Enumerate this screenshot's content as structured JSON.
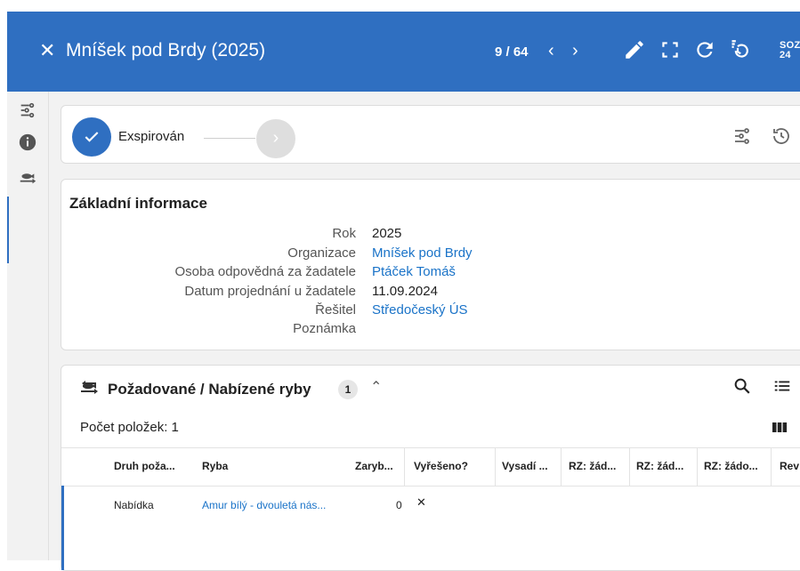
{
  "header": {
    "close_icon": "close-icon",
    "title": "Mníšek pod Brdy (2025)",
    "pager": "9 / 64",
    "prev": "‹",
    "next": "›",
    "actions": [
      "edit-icon",
      "fullscreen-icon",
      "refresh-icon",
      "history-icon"
    ],
    "logo": [
      "SOZ",
      "24"
    ],
    "bg_color": "#2f6fc1"
  },
  "rail": {
    "items": [
      "workflow-icon",
      "info-icon",
      "fish-icon"
    ]
  },
  "status": {
    "label": "Exspirován",
    "next_symbol": "›"
  },
  "info": {
    "title": "Základní informace",
    "rows": [
      {
        "label": "Rok",
        "value": "2025",
        "link": false
      },
      {
        "label": "Organizace",
        "value": "Mníšek pod Brdy",
        "link": true
      },
      {
        "label": "Osoba odpovědná za žadatele",
        "value": "Ptáček Tomáš",
        "link": true
      },
      {
        "label": "Datum projednání u žadatele",
        "value": "11.09.2024",
        "link": false
      },
      {
        "label": "Řešitel",
        "value": "Středočeský ÚS",
        "link": true
      },
      {
        "label": "Poznámka",
        "value": "",
        "link": false
      }
    ]
  },
  "fish": {
    "title": "Požadované / Nabízené ryby",
    "badge": "1",
    "count_label": "Počet položek: 1",
    "columns": [
      "Druh poža...",
      "Ryba",
      "Zaryb...",
      "Vyřešeno?",
      "Vysadí ...",
      "RZ: žád...",
      "RZ: žád...",
      "RZ: žádo...",
      "Rev"
    ],
    "rows": [
      {
        "druh": "Nabídka",
        "ryba": "Amur bílý - dvouletá nás...",
        "zaryb": "0",
        "vyreseno": "✕"
      }
    ]
  },
  "colors": {
    "accent": "#2f6fc1",
    "link": "#1a73c8"
  }
}
